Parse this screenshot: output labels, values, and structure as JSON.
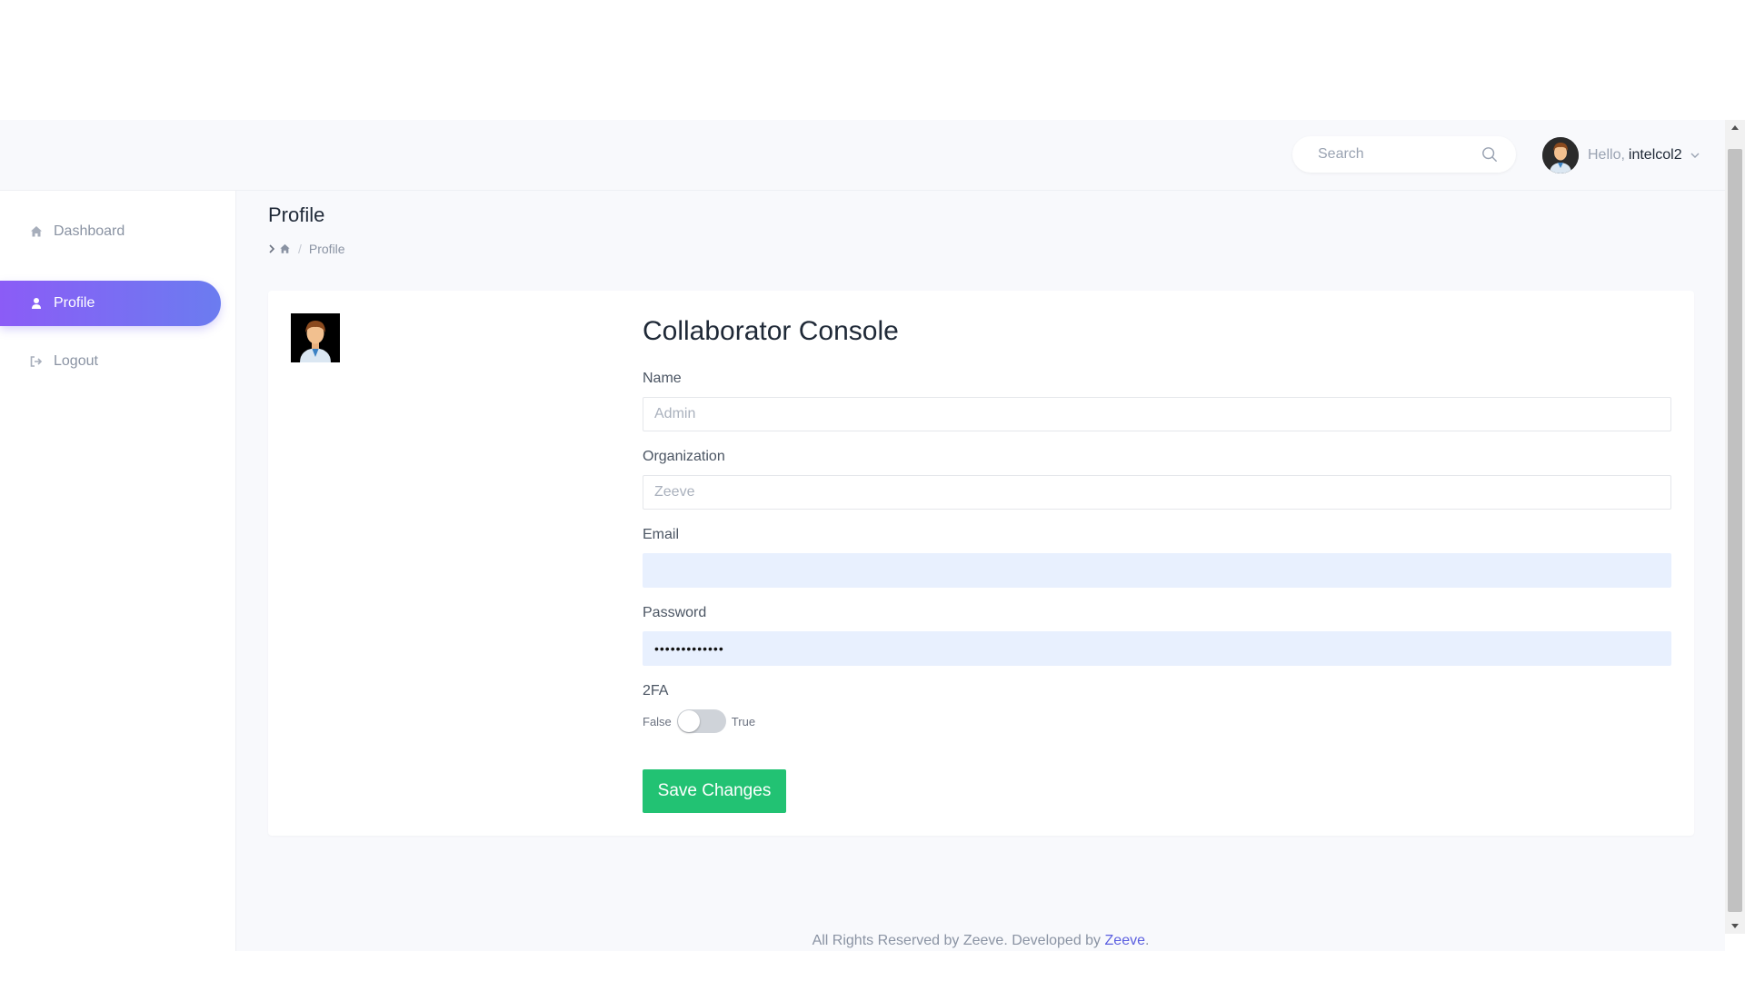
{
  "header": {
    "search_placeholder": "Search",
    "greeting": "Hello,",
    "username": "intelcol2"
  },
  "sidebar": {
    "items": [
      {
        "label": "Dashboard",
        "icon": "home-icon"
      },
      {
        "label": "Profile",
        "icon": "user-icon",
        "active": true
      },
      {
        "label": "Logout",
        "icon": "logout-icon"
      }
    ]
  },
  "page": {
    "title": "Profile",
    "breadcrumb": [
      "home",
      "Profile"
    ]
  },
  "form": {
    "title": "Collaborator Console",
    "name_label": "Name",
    "name_placeholder": "Admin",
    "organization_label": "Organization",
    "organization_placeholder": "Zeeve",
    "email_label": "Email",
    "email_value": "",
    "password_label": "Password",
    "password_value": "•••••••••••••",
    "twofa_label": "2FA",
    "twofa_false": "False",
    "twofa_true": "True",
    "twofa_enabled": false,
    "save_label": "Save Changes"
  },
  "footer": {
    "text": "All Rights Reserved by Zeeve. Developed by",
    "link": "Zeeve",
    "end": "."
  },
  "colors": {
    "accent_gradient_start": "#8b5cf6",
    "accent_gradient_end": "#6b7cf0",
    "save_button": "#22c273",
    "link": "#5b5fe0"
  }
}
